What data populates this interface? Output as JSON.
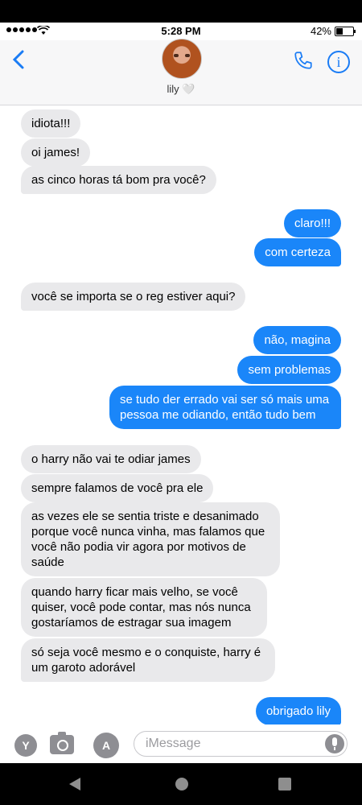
{
  "status": {
    "time": "5:28 PM",
    "battery": "42%"
  },
  "contact": {
    "name": "lily 🤍"
  },
  "messages": [
    {
      "text": "idiota!!!"
    },
    {
      "text": "oi james!"
    },
    {
      "text": "as cinco horas tá bom pra você?"
    },
    {
      "text": "claro!!!"
    },
    {
      "text": "com certeza"
    },
    {
      "text": "você se importa se o reg estiver aqui?"
    },
    {
      "text": "não, magina"
    },
    {
      "text": "sem problemas"
    },
    {
      "text": "se tudo der errado vai ser só mais uma pessoa me odiando, então tudo bem"
    },
    {
      "text": "o harry não vai te odiar james"
    },
    {
      "text": "sempre falamos de você pra ele"
    },
    {
      "text": "as vezes ele se sentia triste e desanimado porque você nunca vinha, mas falamos que você não podia vir agora por motivos de saúde"
    },
    {
      "text": "quando harry ficar mais velho, se você quiser, você pode contar, mas nós nunca gostaríamos de estragar sua imagem"
    },
    {
      "text": "só seja você mesmo e o conquiste, harry é um garoto adorável"
    },
    {
      "text": "obrigado lily"
    }
  ],
  "composer": {
    "placeholder": "iMessage",
    "app_store_icon": "A",
    "yahoo_icon": "Y"
  },
  "colors": {
    "accent": "#1a86f9",
    "incoming": "#e9e9eb"
  },
  "icons": [
    "back-chevron-icon",
    "phone-icon",
    "info-icon",
    "camera-icon",
    "app-store-icon",
    "mic-icon"
  ]
}
